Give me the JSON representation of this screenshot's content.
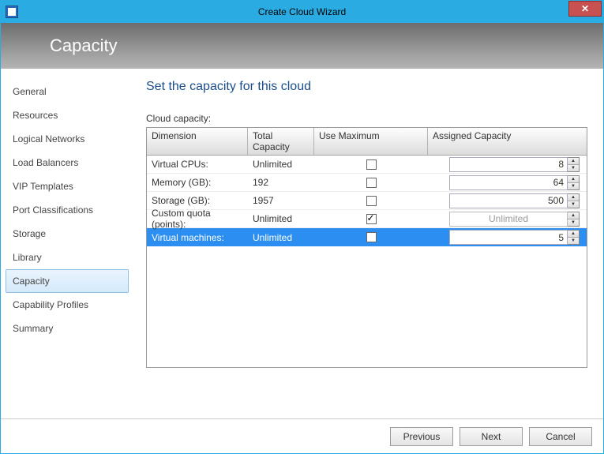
{
  "window": {
    "title": "Create Cloud Wizard",
    "close_icon": "✕"
  },
  "banner": {
    "title": "Capacity"
  },
  "sidebar": {
    "items": [
      {
        "label": "General"
      },
      {
        "label": "Resources"
      },
      {
        "label": "Logical Networks"
      },
      {
        "label": "Load Balancers"
      },
      {
        "label": "VIP Templates"
      },
      {
        "label": "Port Classifications"
      },
      {
        "label": "Storage"
      },
      {
        "label": "Library"
      },
      {
        "label": "Capacity"
      },
      {
        "label": "Capability Profiles"
      },
      {
        "label": "Summary"
      }
    ],
    "selected_index": 8
  },
  "main": {
    "heading": "Set the capacity for this cloud",
    "section_label": "Cloud capacity:",
    "columns": {
      "dimension": "Dimension",
      "total_capacity": "Total Capacity",
      "use_maximum": "Use Maximum",
      "assigned_capacity": "Assigned Capacity"
    },
    "rows": [
      {
        "dimension": "Virtual CPUs:",
        "total": "Unlimited",
        "use_max": false,
        "assigned": "8",
        "editable": true
      },
      {
        "dimension": "Memory (GB):",
        "total": "192",
        "use_max": false,
        "assigned": "64",
        "editable": true
      },
      {
        "dimension": "Storage (GB):",
        "total": "1957",
        "use_max": false,
        "assigned": "500",
        "editable": true
      },
      {
        "dimension": "Custom quota (points):",
        "total": "Unlimited",
        "use_max": true,
        "assigned": "Unlimited",
        "editable": false
      },
      {
        "dimension": "Virtual machines:",
        "total": "Unlimited",
        "use_max": false,
        "assigned": "5",
        "editable": true
      }
    ],
    "selected_row_index": 4
  },
  "footer": {
    "previous": "Previous",
    "next": "Next",
    "cancel": "Cancel"
  }
}
